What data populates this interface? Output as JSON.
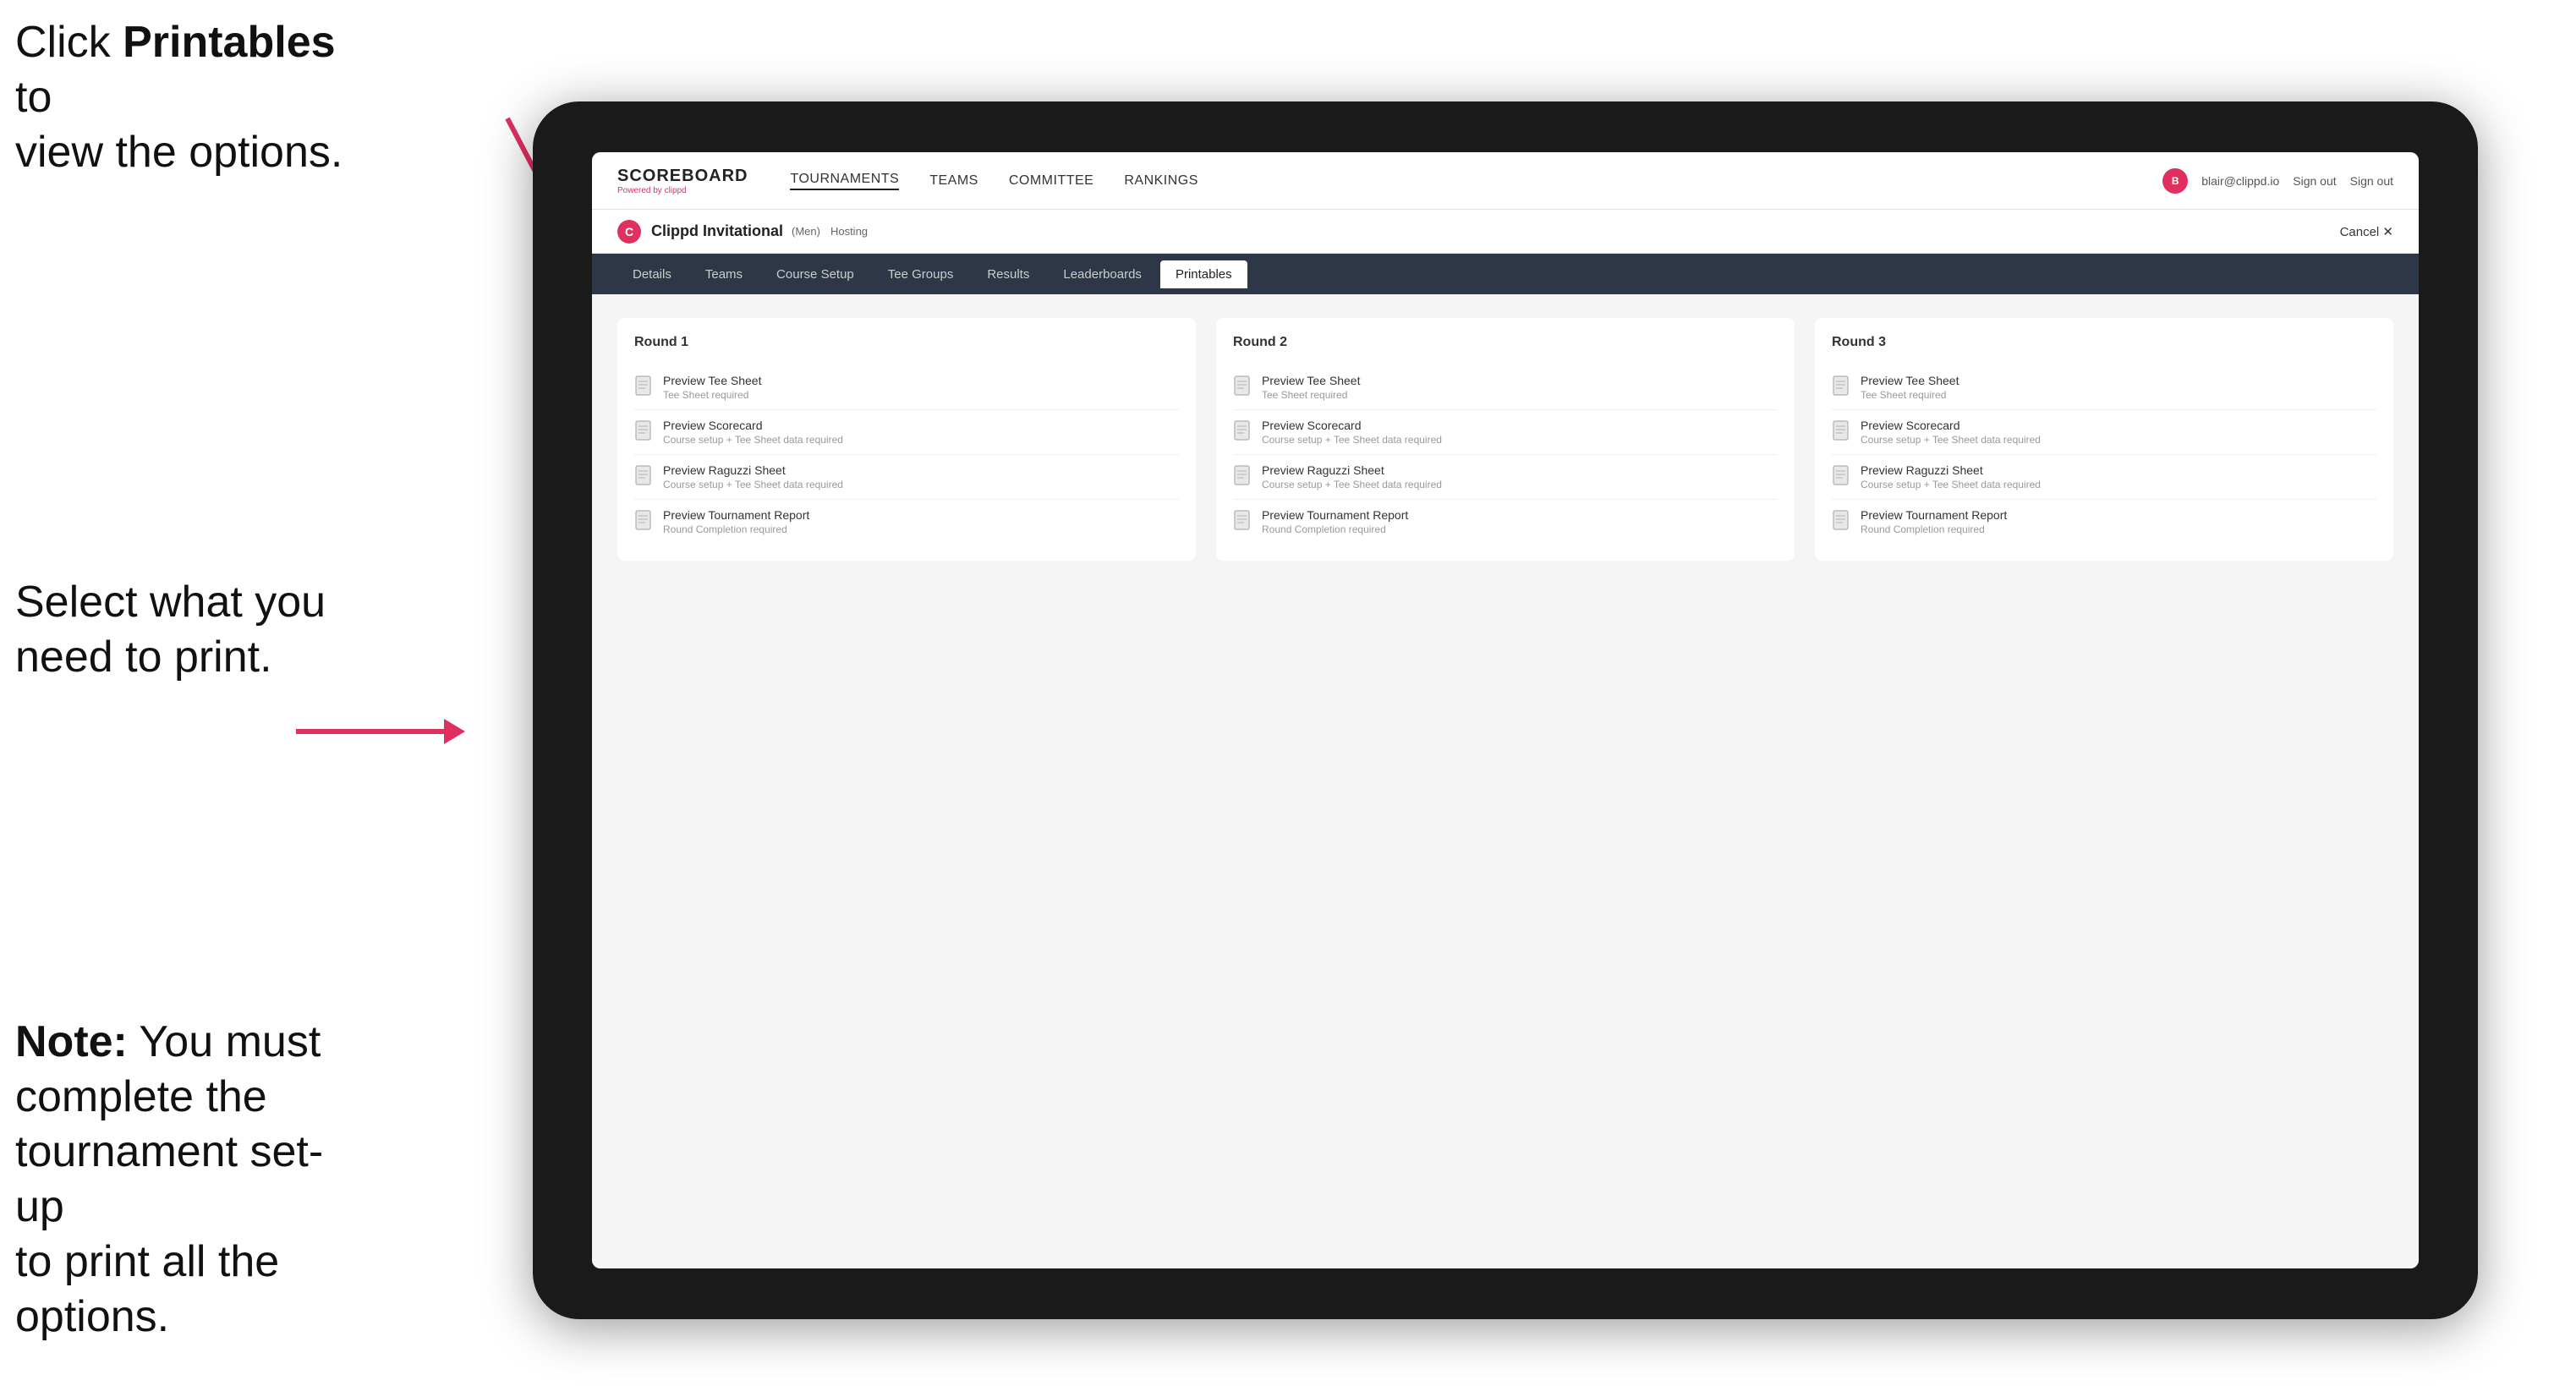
{
  "annotations": {
    "top": {
      "line1": "Click ",
      "bold": "Printables",
      "line2": " to",
      "line3": "view the options."
    },
    "middle": {
      "text": "Select what you need to print."
    },
    "bottom": {
      "bold": "Note:",
      "text": " You must complete the tournament set-up to print all the options."
    }
  },
  "topNav": {
    "logo": "SCOREBOARD",
    "logoSub": "Powered by clippd",
    "items": [
      "TOURNAMENTS",
      "TEAMS",
      "COMMITTEE",
      "RANKINGS"
    ],
    "user": "blair@clippd.io",
    "signOut": "Sign out"
  },
  "tournament": {
    "name": "Clippd Invitational",
    "badge": "(Men)",
    "status": "Hosting",
    "cancel": "Cancel ✕"
  },
  "subNav": {
    "items": [
      "Details",
      "Teams",
      "Course Setup",
      "Tee Groups",
      "Results",
      "Leaderboards",
      "Printables"
    ],
    "active": "Printables"
  },
  "rounds": [
    {
      "title": "Round 1",
      "items": [
        {
          "name": "Preview Tee Sheet",
          "note": "Tee Sheet required"
        },
        {
          "name": "Preview Scorecard",
          "note": "Course setup + Tee Sheet data required"
        },
        {
          "name": "Preview Raguzzi Sheet",
          "note": "Course setup + Tee Sheet data required"
        },
        {
          "name": "Preview Tournament Report",
          "note": "Round Completion required"
        }
      ]
    },
    {
      "title": "Round 2",
      "items": [
        {
          "name": "Preview Tee Sheet",
          "note": "Tee Sheet required"
        },
        {
          "name": "Preview Scorecard",
          "note": "Course setup + Tee Sheet data required"
        },
        {
          "name": "Preview Raguzzi Sheet",
          "note": "Course setup + Tee Sheet data required"
        },
        {
          "name": "Preview Tournament Report",
          "note": "Round Completion required"
        }
      ]
    },
    {
      "title": "Round 3",
      "items": [
        {
          "name": "Preview Tee Sheet",
          "note": "Tee Sheet required"
        },
        {
          "name": "Preview Scorecard",
          "note": "Course setup + Tee Sheet data required"
        },
        {
          "name": "Preview Raguzzi Sheet",
          "note": "Course setup + Tee Sheet data required"
        },
        {
          "name": "Preview Tournament Report",
          "note": "Round Completion required"
        }
      ]
    }
  ]
}
